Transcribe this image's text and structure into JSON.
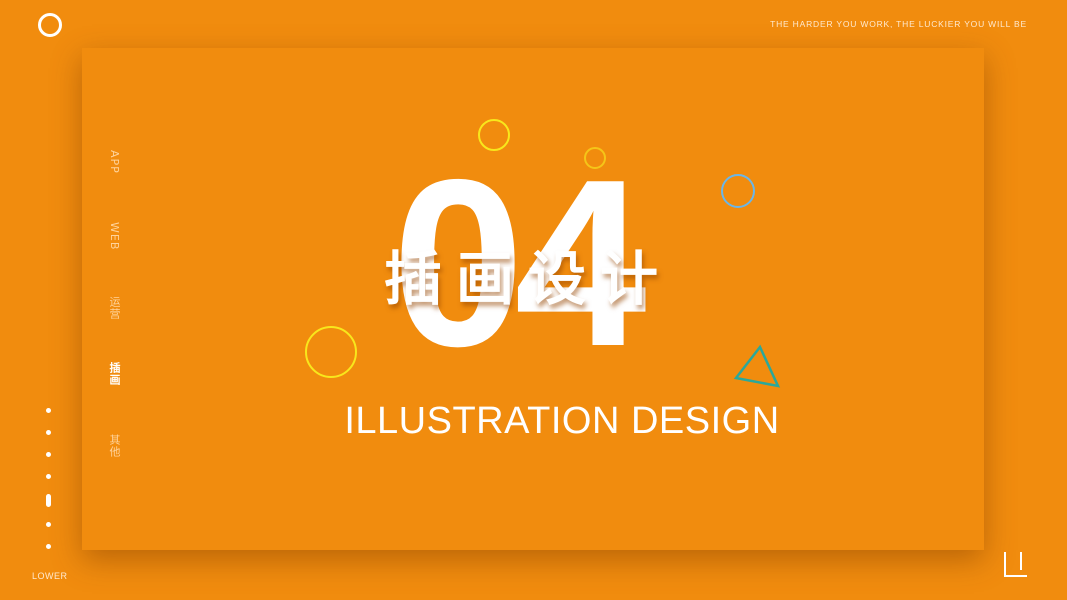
{
  "header": {
    "tagline": "THE HARDER YOU WORK, THE LUCKIER YOU WILL BE",
    "logo_icon": "ring-icon"
  },
  "side_nav": {
    "items": [
      {
        "label": "APP",
        "active": false
      },
      {
        "label": "WEB",
        "active": false
      },
      {
        "label": "运营",
        "active": false
      },
      {
        "label": "插画",
        "active": true
      },
      {
        "label": "其他",
        "active": false
      }
    ]
  },
  "pager": {
    "label": "LOWER",
    "total": 7,
    "active_index": 4
  },
  "hero": {
    "number": "04",
    "title_cn": "插画设计",
    "title_en": "ILLUSTRATION DESIGN"
  },
  "colors": {
    "background": "#F18C0E",
    "text": "#FFFFFF",
    "muted_text": "#FFD39B",
    "deco_yellow": "#F8E71C",
    "deco_gold": "#F5C518",
    "deco_blue": "#6BB6E8",
    "deco_teal": "#2BA89A"
  }
}
